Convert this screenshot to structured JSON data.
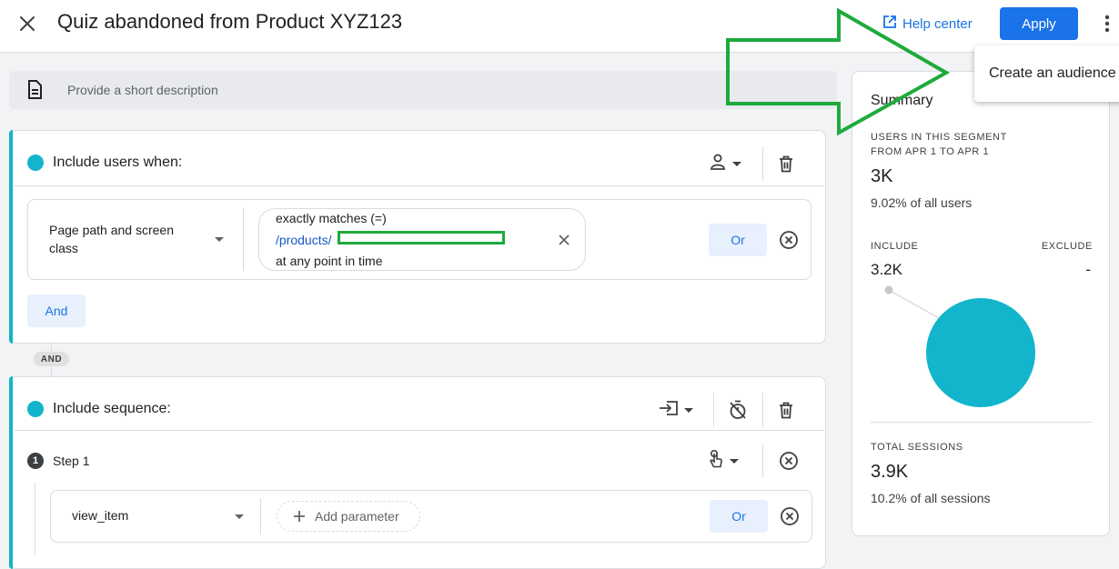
{
  "header": {
    "title": "Quiz abandoned from Product XYZ123",
    "help_label": "Help center",
    "apply_label": "Apply"
  },
  "description": {
    "placeholder": "Provide a short description"
  },
  "card1": {
    "heading": "Include users when:",
    "dimension": "Page path and screen class",
    "operator": "exactly matches (=)",
    "value": "/products/",
    "time_scope": "at any point in time",
    "or_label": "Or",
    "and_label": "And"
  },
  "connector": {
    "label": "AND"
  },
  "card2": {
    "heading": "Include sequence:",
    "step_number": "1",
    "step_label": "Step 1",
    "event": "view_item",
    "add_param_label": "Add parameter",
    "or_label": "Or"
  },
  "summary": {
    "title": "Summary",
    "users_caption_line1": "USERS IN THIS SEGMENT",
    "users_caption_line2": "FROM APR 1 TO APR 1",
    "users_value": "3K",
    "users_pct": "9.02% of all users",
    "include_label": "INCLUDE",
    "exclude_label": "EXCLUDE",
    "include_value": "3.2K",
    "exclude_value": "-",
    "sessions_caption": "TOTAL SESSIONS",
    "sessions_value": "3.9K",
    "sessions_pct": "10.2% of all sessions"
  },
  "menu": {
    "item": "Create an audience"
  },
  "colors": {
    "accent_teal": "#12b5cb",
    "brand_blue": "#1a73e8",
    "annotation_green": "#1eaa3c"
  }
}
